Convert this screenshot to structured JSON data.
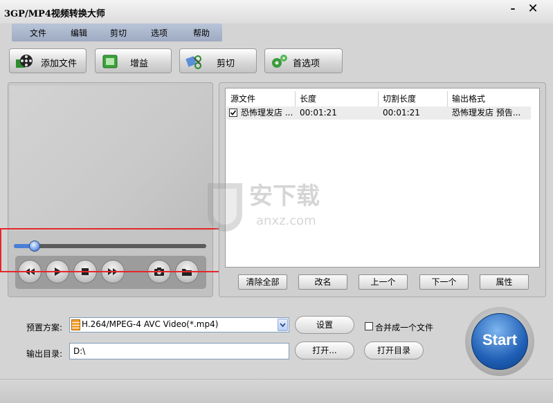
{
  "window": {
    "title": "3GP/MP4视频转换大师",
    "minimize": "–",
    "close": "✕"
  },
  "menu": [
    "文件",
    "编辑",
    "剪切",
    "选项",
    "帮助"
  ],
  "toolbar": {
    "add_file": {
      "label": "添加文件",
      "icon": "film-reel-icon"
    },
    "gain": {
      "label": "增益",
      "icon": "gain-icon"
    },
    "cut": {
      "label": "剪切",
      "icon": "scissors-icon"
    },
    "options": {
      "label": "首选项",
      "icon": "gears-icon"
    }
  },
  "player": {
    "seek_progress": 0.08,
    "controls": [
      "rewind-icon",
      "play-icon",
      "stop-icon",
      "fast-forward-icon",
      "snapshot-icon",
      "folder-icon"
    ]
  },
  "file_list": {
    "columns": [
      "源文件",
      "长度",
      "切割长度",
      "输出格式"
    ],
    "rows": [
      {
        "checked": true,
        "source": "恐怖理发店 ...",
        "length": "00:01:21",
        "cut_length": "00:01:21",
        "format": "恐怖理发店 预告..."
      }
    ],
    "buttons": {
      "clear_all": "清除全部",
      "rename": "改名",
      "move_up": "上一个",
      "move_down": "下一个",
      "properties": "属性"
    }
  },
  "settings": {
    "preset_label": "预置方案:",
    "preset_value": "H.264/MPEG-4 AVC Video(*.mp4)",
    "settings_button": "设置",
    "merge_label": "合并成一个文件",
    "merge_checked": false,
    "output_label": "输出目录:",
    "output_value": "D:\\",
    "open_button": "打开...",
    "open_dir_button": "打开目录"
  },
  "start_button": "Start",
  "watermark": {
    "main": "安下载",
    "sub": "anxz.com"
  },
  "colors": {
    "accent_red": "#e5262a",
    "start_blue": "#1f5fb5",
    "menu_bg": "#b0bcd1"
  }
}
